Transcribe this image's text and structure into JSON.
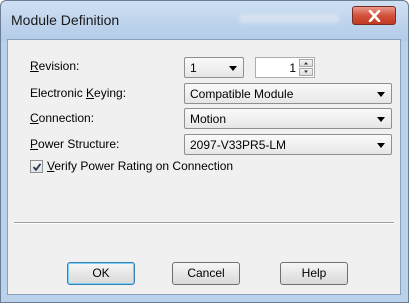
{
  "window": {
    "title": "Module Definition",
    "close_icon": "close-icon"
  },
  "fields": {
    "revision": {
      "label_mnemonic": "R",
      "label_rest": "evision:",
      "major_value": "1",
      "minor_value": "1"
    },
    "electronic_keying": {
      "label_pre": "Electronic ",
      "label_mnemonic": "K",
      "label_rest": "eying:",
      "value": "Compatible Module"
    },
    "connection": {
      "label_mnemonic": "C",
      "label_rest": "onnection:",
      "value": "Motion"
    },
    "power_structure": {
      "label_mnemonic": "P",
      "label_rest": "ower Structure:",
      "value": "2097-V33PR5-LM"
    },
    "verify_power": {
      "label_mnemonic": "V",
      "label_rest": "erify Power Rating on Connection",
      "checked": true
    }
  },
  "buttons": {
    "ok": "OK",
    "cancel": "Cancel",
    "help": "Help"
  },
  "colors": {
    "titlebar": "#bdd3ec",
    "close_button": "#c0391f",
    "client_background": "#f0f0f0"
  }
}
